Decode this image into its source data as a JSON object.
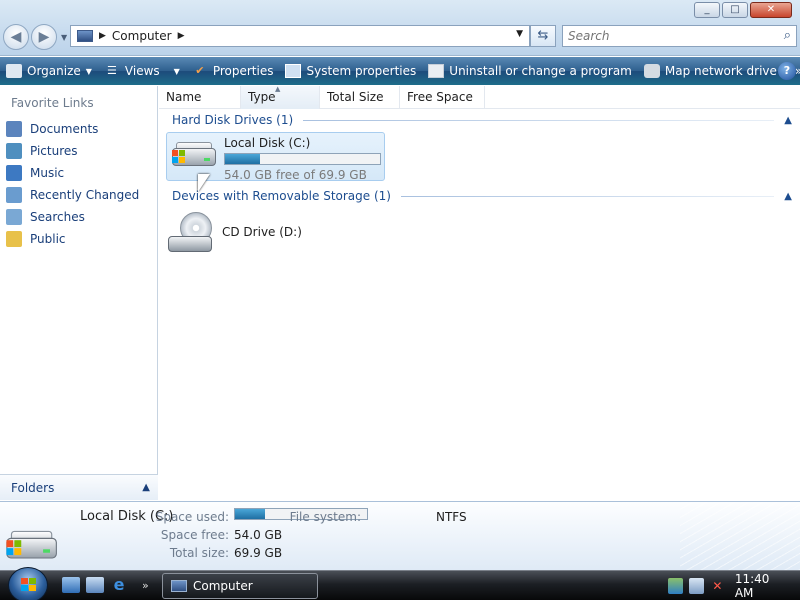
{
  "window": {
    "buttons": [
      "_",
      "□",
      "✕"
    ]
  },
  "address": {
    "crumb": "Computer",
    "search_placeholder": "Search"
  },
  "toolbar": {
    "items": [
      {
        "label": "Organize",
        "icon": "organize-icon",
        "has_dropdown": true
      },
      {
        "label": "Views",
        "icon": "views-icon",
        "has_dropdown": true
      },
      {
        "label": "Properties",
        "icon": "properties-icon"
      },
      {
        "label": "System properties",
        "icon": "system-properties-icon"
      },
      {
        "label": "Uninstall or change a program",
        "icon": "uninstall-icon"
      },
      {
        "label": "Map network drive",
        "icon": "map-network-drive-icon"
      }
    ],
    "more": "»",
    "help": "?"
  },
  "sidebar": {
    "heading": "Favorite Links",
    "items": [
      {
        "label": "Documents",
        "icon": "documents-icon",
        "color": "#5b84bd"
      },
      {
        "label": "Pictures",
        "icon": "pictures-icon",
        "color": "#4f8fbf"
      },
      {
        "label": "Music",
        "icon": "music-icon",
        "color": "#3d79c2"
      },
      {
        "label": "Recently Changed",
        "icon": "recently-changed-icon",
        "color": "#6a9ccf"
      },
      {
        "label": "Searches",
        "icon": "searches-icon",
        "color": "#7aa8d4"
      },
      {
        "label": "Public",
        "icon": "public-folder-icon",
        "color": "#e8c14a"
      }
    ],
    "folders_label": "Folders"
  },
  "columns": [
    "Name",
    "Type",
    "Total Size",
    "Free Space"
  ],
  "groups": {
    "hard_disk": "Hard Disk Drives (1)",
    "removable": "Devices with Removable Storage (1)"
  },
  "drives": {
    "c": {
      "name": "Local Disk (C:)",
      "free_text": "54.0 GB free of 69.9 GB",
      "used_fraction": 0.227
    },
    "d": {
      "name": "CD Drive (D:)"
    }
  },
  "details": {
    "title": "Local Disk (C:)",
    "space_used_label": "Space used:",
    "space_free_label": "Space free:",
    "space_free": "54.0 GB",
    "total_size_label": "Total size:",
    "total_size": "69.9 GB",
    "file_system_label": "File system:",
    "file_system": "NTFS"
  },
  "taskbar": {
    "more": "»",
    "active_window": "Computer",
    "clock": "11:40 AM"
  }
}
